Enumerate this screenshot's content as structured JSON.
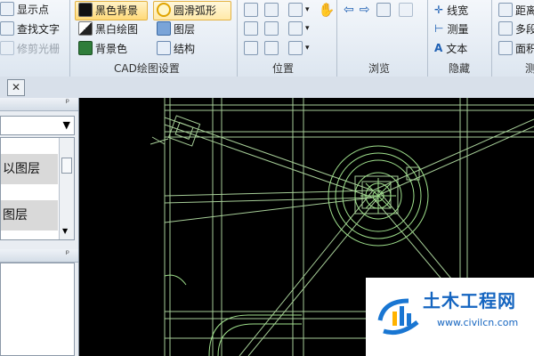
{
  "ribbon": {
    "col1": [
      "显示点",
      "查找文字",
      "修剪光栅"
    ],
    "cad": {
      "black_bg": "黑色背景",
      "bw_draw": "黑白绘图",
      "bg_color": "背景色",
      "smooth_arc": "圆滑弧形",
      "layer": "图层",
      "structure": "结构"
    },
    "col_right": [
      "线宽",
      "测量",
      "文本"
    ],
    "col_far": [
      "距离",
      "多段",
      "面积"
    ],
    "groups": {
      "cad": "CAD绘图设置",
      "position": "位置",
      "browse": "浏览",
      "hide": "隐藏",
      "measure": "测"
    }
  },
  "tab_close": "✕",
  "panel": {
    "pin1": "ᵖ",
    "pin2": "ᵖ",
    "rows": [
      "以图层",
      "图层"
    ]
  },
  "watermark": {
    "title": "土木工程网",
    "url": "www.civilcn.com"
  }
}
